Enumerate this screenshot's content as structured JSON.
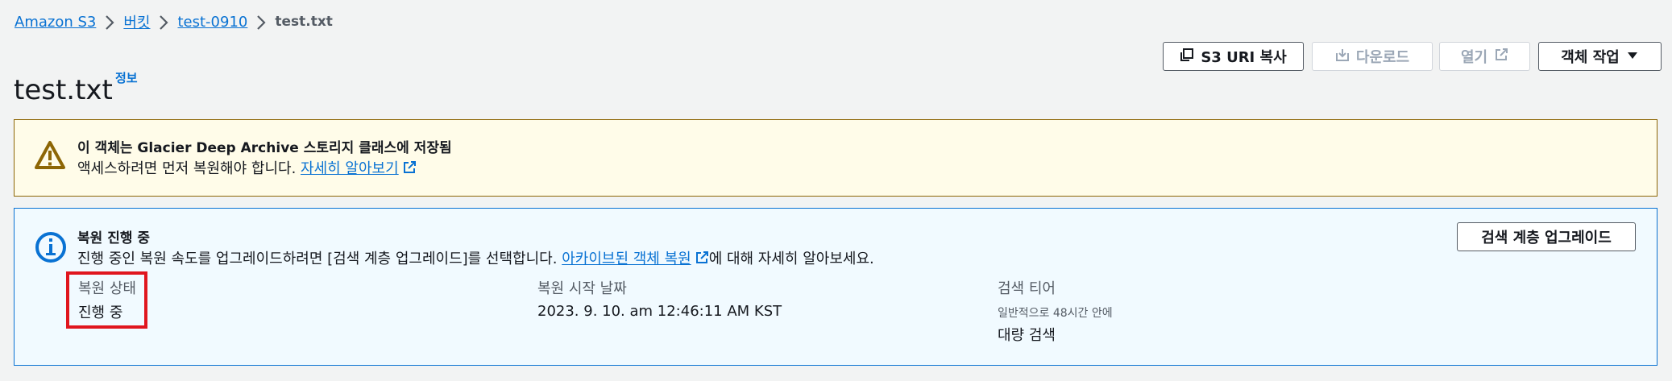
{
  "breadcrumb": {
    "items": [
      {
        "label": "Amazon S3"
      },
      {
        "label": "버킷"
      },
      {
        "label": "test-0910"
      },
      {
        "label": "test.txt"
      }
    ]
  },
  "header": {
    "title": "test.txt",
    "info_link": "정보",
    "buttons": {
      "copy_uri": "S3 URI 복사",
      "download": "다운로드",
      "open": "열기",
      "actions": "객체 작업"
    }
  },
  "warning": {
    "title": "이 객체는 Glacier Deep Archive 스토리지 클래스에 저장됨",
    "body_text": "액세스하려면 먼저 복원해야 합니다.",
    "link": "자세히 알아보기"
  },
  "restore": {
    "title": "복원 진행 중",
    "body_prefix": "진행 중인 복원 속도를 업그레이드하려면 [검색 계층 업그레이드]를 선택합니다.",
    "body_link": "아카이브된 객체 복원",
    "body_suffix": "에 대해 자세히 알아보세요.",
    "upgrade_button": "검색 계층 업그레이드",
    "status_label": "복원 상태",
    "status_value": "진행 중",
    "start_date_label": "복원 시작 날짜",
    "start_date_value": "2023. 9. 10. am 12:46:11 AM KST",
    "tier_label": "검색 티어",
    "tier_note": "일반적으로 48시간 안에",
    "tier_value": "대량 검색"
  },
  "colors": {
    "link": "#0972d3",
    "warning_bg": "#fffce9",
    "warning_border": "#8d6605",
    "info_bg": "#f1faff",
    "info_border": "#0972d3",
    "highlight": "#e0161e"
  },
  "icons": [
    "chevron-right-icon",
    "copy-icon",
    "download-icon",
    "external-link-icon",
    "caret-down-icon",
    "warning-icon",
    "info-icon"
  ]
}
